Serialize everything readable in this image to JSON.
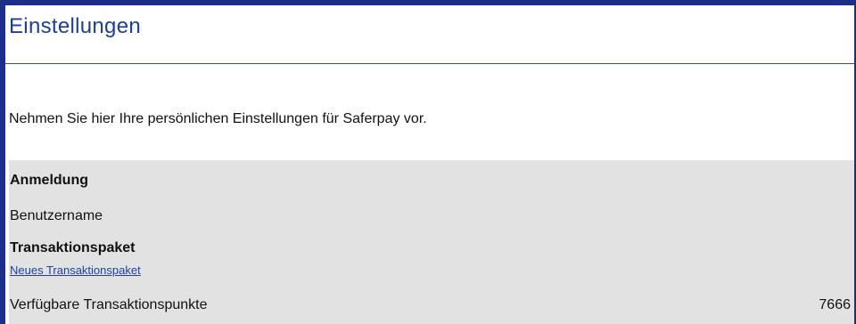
{
  "page": {
    "title": "Einstellungen",
    "intro": "Nehmen Sie hier Ihre persönlichen Einstellungen für Saferpay vor."
  },
  "settings": {
    "anmeldung_heading": "Anmeldung",
    "benutzername_label": "Benutzername",
    "transaktionspaket_heading": "Transaktionspaket",
    "new_package_link": "Neues Transaktionspaket",
    "points_label": "Verfügbare Transaktionspunkte",
    "points_value": "7666"
  },
  "colors": {
    "frame": "#1c2e8a",
    "title": "#1b3f9a",
    "panel": "#e2e2e2",
    "link": "#1f3fa3"
  }
}
